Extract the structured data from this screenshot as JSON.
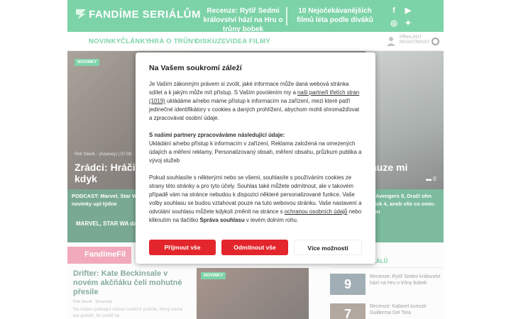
{
  "site": {
    "logo_text": "FANDÍME SERIÁLŮM",
    "promo_1": "Recenze: Rytíř Sedmi království hází na Hru o trůny bobek",
    "promo_2": "10 Nejočekávanějších filmů léta podle diváků",
    "social_icons": [
      "facebook-icon",
      "youtube-icon",
      "instagram-icon",
      "twitter-icon"
    ],
    "nav": [
      "NOVINKY",
      "ČLÁNKY",
      "HRA O TRŮNY",
      "DISKUZE",
      "VIDEA",
      "FILMY"
    ],
    "user_link_1": "PŘIHLÁSIT",
    "user_link_2": "REGISTROVAT",
    "hero_tag": "NOVINKY",
    "hero_meta": "Petr Slavík - (Azarvey) | 07.08",
    "hero_title_left": "Zrádci: Hráči dál než kdyk",
    "hero_title_right": "auze mi",
    "hero_comments": "0",
    "strip_left": "PODCAST: Marvel, Star W další Disney novinky upl týdne",
    "strip_left_sub": "MARVEL, STAR WA další DISNEY novi",
    "strip_right": "T: Avengers 5, Dračí ohn Wick 4, aneb vše co omic-Con",
    "fandom_box": "FandímeFil",
    "card_title": "Drifter: Kate Beckinsale v novém akčňáku čelí mohutné přesile",
    "card_meta": "Petr Slavík - (Azarvey)",
    "card_text": "Na malou policejní stanici tradiční pošťák, který nemá ani ponětí, že uvnitř se",
    "mid_tag": "NOVINKY",
    "side_head": "ZÁLŮ",
    "side_items": [
      {
        "num": "9",
        "text": "Recenze: Rytíř Sedmi království hází na Hru o trůny bobek"
      },
      {
        "num": "7",
        "text": "Recenze: Kabinet kuriozit Guillerma Del Tora"
      }
    ]
  },
  "consent": {
    "title": "Na Vašem soukromí záleží",
    "p1_a": "Je Vaším zákonným právem si zvolit, jaké informace může daná webová stránka sdílet a k jakým může mít přístup. S Vaším povolením my a ",
    "p1_link": "naši partneři třetích stran (1019)",
    "p1_b": " ukládáme a/nebo máme přístup k informacím na zařízení, mezi které patří jedinečné identifikátory v cookies a daných prohlížení, abychom mohli shromažďovat a zpracovávat osobní údaje.",
    "p2_heading": "S našimi partnery zpracováváme následující údaje:",
    "p2_text": "Ukládání a/nebo přístup k informacím v zařízení, Reklama založená na omezených údajích a měření reklamy, Personalizovaný obsah, měření obsahu, průzkum publika a vývoj služeb",
    "p3_a": "Pokud souhlasíte s některými nebo se všemi, souhlasíte s používáním cookies ze strany této stránky a pro tyto účely. Souhlas také můžete odmítnout, ale v takovém případě vám na stránce nebudou k dispozici některé personalizované funkce. Vaše volby souhlasu se budou vztahovat pouze na tuto webovou stránku. Vaše nastavení a odvolání souhlasu můžete kdykoli změnit na stránce s ",
    "p3_link": "ochranou osobních údajů",
    "p3_b": " nebo kliknutím na tlačítko ",
    "p3_bold": "Správa souhlasu",
    "p3_c": " v levém dolním rohu.",
    "btn_accept": "Přijmout vše",
    "btn_reject": "Odmítnout vše",
    "btn_more": "Více možností",
    "accent_color": "#e3262c"
  }
}
